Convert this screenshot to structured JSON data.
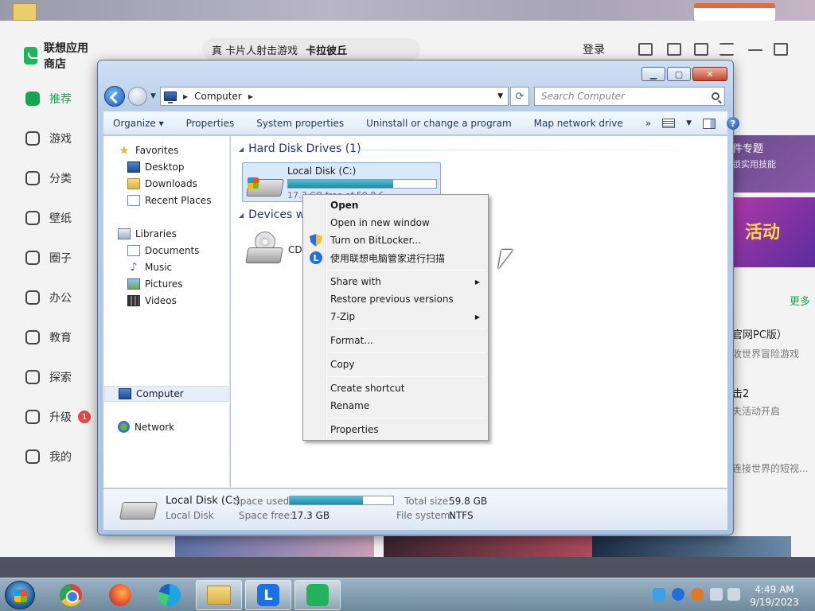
{
  "app_store": {
    "title": "联想应用商店",
    "nav": [
      {
        "label": "推荐",
        "active": true
      },
      {
        "label": "游戏"
      },
      {
        "label": "分类"
      },
      {
        "label": "壁纸"
      },
      {
        "label": "圈子"
      },
      {
        "label": "办公"
      },
      {
        "label": "教育"
      },
      {
        "label": "探索"
      },
      {
        "label": "升级",
        "badge": "1"
      },
      {
        "label": "我的"
      }
    ],
    "search_prefix": "真 卡片人射击游戏",
    "search_bold": "卡拉彼丘",
    "login": "登录",
    "banner_title": "件专题",
    "banner_sub": "锁实用技能",
    "banner2_text": "活动",
    "more": "更多",
    "side_texts": [
      "官网PC版）",
      "收世界冒险游戏",
      "击2",
      "夫活动开启",
      "连接世界的短视..."
    ],
    "colors": {
      "accent": "#18a550"
    }
  },
  "explorer": {
    "address": {
      "segment": "Computer"
    },
    "search_placeholder": "Search Computer",
    "toolbar": [
      "Organize ▾",
      "Properties",
      "System properties",
      "Uninstall or change a program",
      "Map network drive",
      "»"
    ],
    "nav_pane": {
      "favorites": "Favorites",
      "favorites_items": [
        "Desktop",
        "Downloads",
        "Recent Places"
      ],
      "libraries": "Libraries",
      "libraries_items": [
        "Documents",
        "Music",
        "Pictures",
        "Videos"
      ],
      "computer": "Computer",
      "network": "Network"
    },
    "groups": {
      "hdd": "Hard Disk Drives (1)",
      "devices": "Devices wi"
    },
    "drive": {
      "name": "Local Disk (C:)",
      "free_text": "17.3 GB free of 59.8 GB",
      "used_fraction": 0.71
    },
    "cd": {
      "name": "CD"
    },
    "details": {
      "name": "Local Disk (C:)",
      "type": "Local Disk",
      "space_used_label": "Space used:",
      "space_free_label": "Space free:",
      "space_free": "17.3 GB",
      "total_size_label": "Total size:",
      "total_size": "59.8 GB",
      "fs_label": "File system:",
      "fs": "NTFS"
    }
  },
  "context_menu": {
    "items": [
      {
        "label": "Open",
        "bold": true
      },
      {
        "label": "Open in new window"
      },
      {
        "label": "Turn on BitLocker...",
        "icon": "shield-icon"
      },
      {
        "label": "使用联想电脑管家进行扫描",
        "icon": "lenovo-icon"
      },
      {
        "label": "Share with",
        "submenu": true
      },
      {
        "label": "Restore previous versions"
      },
      {
        "label": "7-Zip",
        "submenu": true
      },
      {
        "label": "Format..."
      },
      {
        "label": "Copy"
      },
      {
        "label": "Create shortcut"
      },
      {
        "label": "Rename"
      },
      {
        "label": "Properties"
      }
    ]
  },
  "taskbar": {
    "time": "4:49 AM",
    "date": "9/19/2023"
  }
}
